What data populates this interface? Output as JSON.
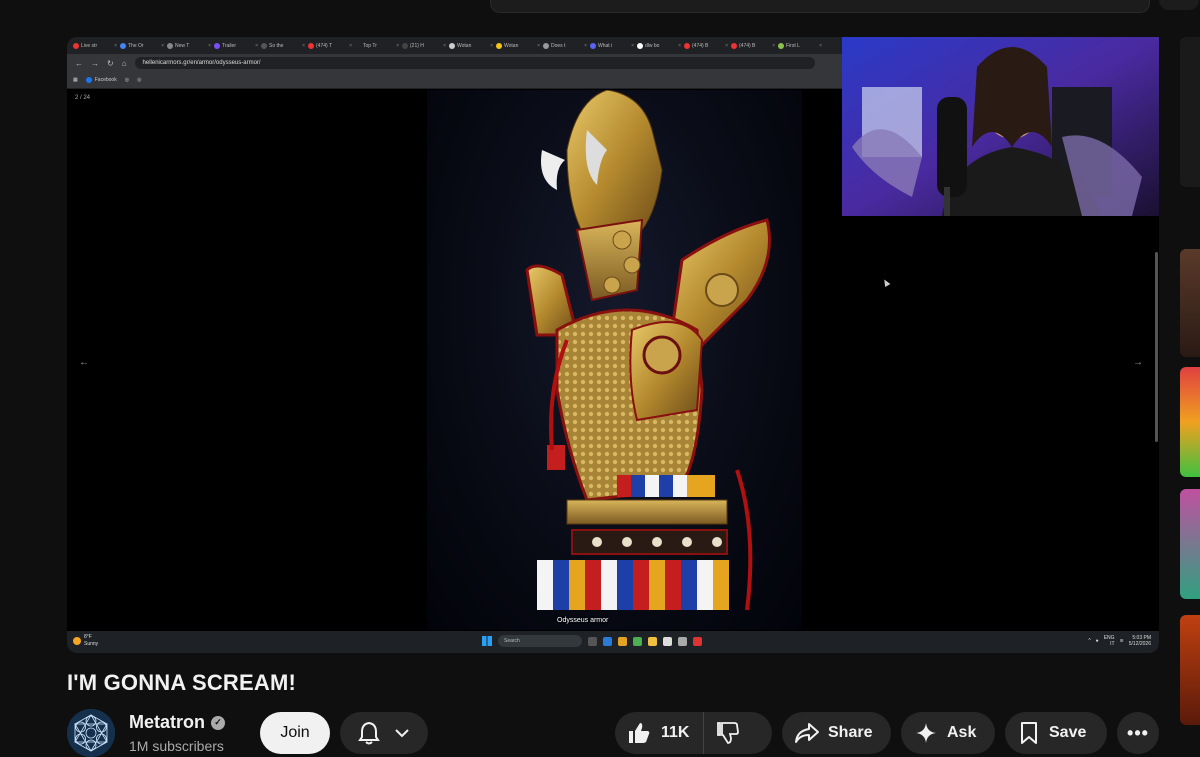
{
  "browser": {
    "tabs": [
      "Live str",
      "The Or",
      "New T",
      "Trailer",
      "So the",
      "(474) T",
      "Top Tr",
      "(21) H",
      "Wotan",
      "Wotan",
      "Does t",
      "What i",
      "dlw bo",
      "(474) B",
      "(474) B",
      "First L"
    ],
    "url": "hellenicarmors.gr/en/armor/odysseus-armor/",
    "bookmark": "Facebook"
  },
  "slide": {
    "counter": "2 / 24",
    "caption": "Odysseus armor",
    "prev_icon": "arrow-left-icon",
    "next_icon": "arrow-right-icon"
  },
  "taskbar": {
    "weather_temp": "8°F",
    "weather_desc": "Sunny",
    "search_placeholder": "Search",
    "lang_top": "ENG",
    "lang_bottom": "IT",
    "time": "5:03 PM",
    "date": "5/12/2026"
  },
  "video": {
    "title": "I'M GONNA SCREAM!"
  },
  "channel": {
    "name": "Metatron",
    "subscribers": "1M subscribers",
    "join_label": "Join"
  },
  "actions": {
    "likes": "11K",
    "share_label": "Share",
    "ask_label": "Ask",
    "save_label": "Save"
  },
  "colors": {
    "background": "#0f0f0f",
    "button_bg": "#272727",
    "join_bg": "#f1f1f1",
    "text": "#f1f1f1",
    "subtext": "#aaaaaa"
  }
}
